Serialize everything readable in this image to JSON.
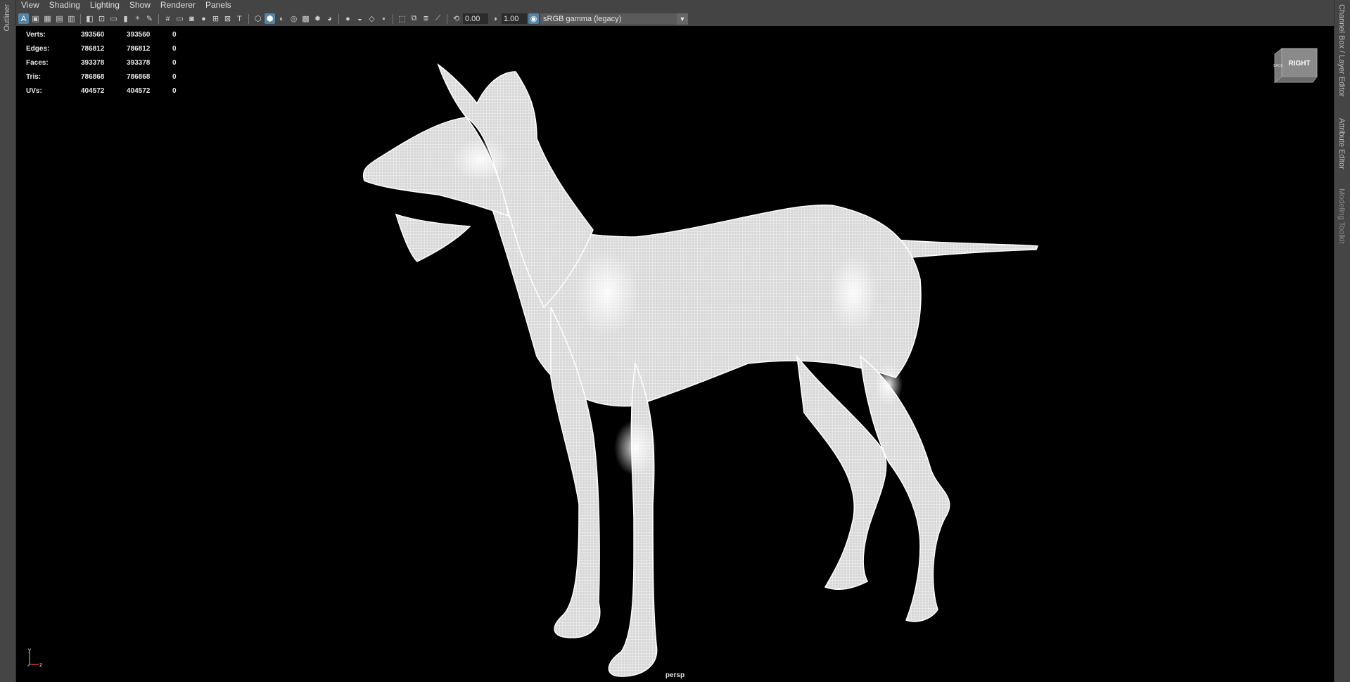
{
  "left_panel": {
    "tab": "Outliner"
  },
  "right_panel": {
    "tabs": [
      "Channel Box / Layer Editor",
      "Attribute Editor",
      "Modeling Toolkit"
    ]
  },
  "menubar": {
    "items": [
      "View",
      "Shading",
      "Lighting",
      "Show",
      "Renderer",
      "Panels"
    ]
  },
  "toolbar": {
    "exposure": "0.00",
    "gamma": "1.00",
    "color_management": "sRGB gamma (legacy)"
  },
  "hud": {
    "rows": [
      {
        "label": "Verts:",
        "v1": "393560",
        "v2": "393560",
        "v3": "0"
      },
      {
        "label": "Edges:",
        "v1": "786812",
        "v2": "786812",
        "v3": "0"
      },
      {
        "label": "Faces:",
        "v1": "393378",
        "v2": "393378",
        "v3": "0"
      },
      {
        "label": "Tris:",
        "v1": "786868",
        "v2": "786868",
        "v3": "0"
      },
      {
        "label": "UVs:",
        "v1": "404572",
        "v2": "404572",
        "v3": "0"
      }
    ]
  },
  "viewport": {
    "camera": "persp",
    "viewcube_face": "RIGHT",
    "viewcube_side": "BACK",
    "axis_y": "y",
    "axis_z": "z"
  }
}
